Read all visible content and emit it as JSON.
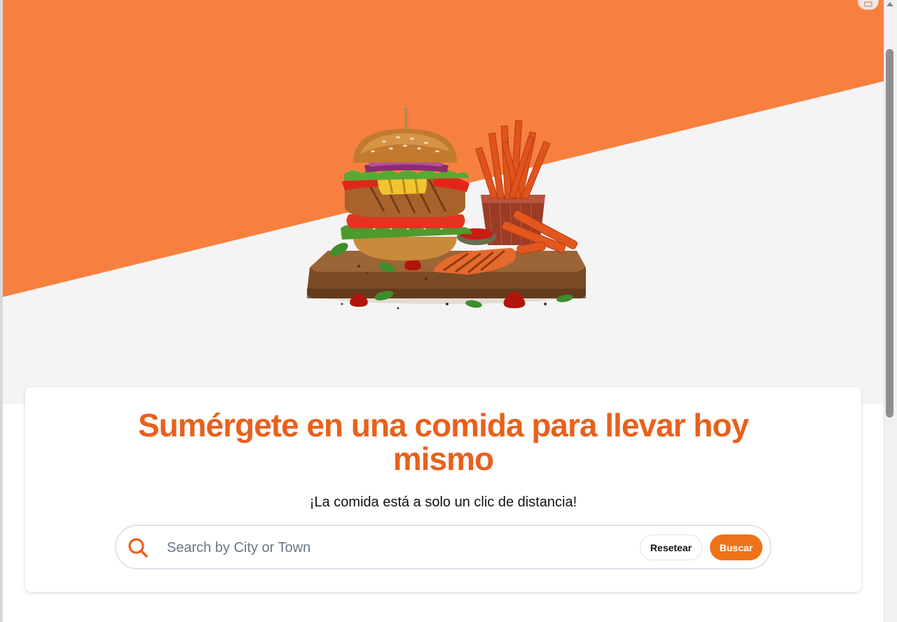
{
  "hero": {
    "image_alt": "Burger with sweet potato fries on a wooden board",
    "colors": {
      "orange": "#f7803f",
      "light_gray": "#f4f4f4"
    }
  },
  "search_section": {
    "headline": "Sumérgete en una comida para llevar hoy mismo",
    "subtitle": "¡La comida está a solo un clic de distancia!",
    "search": {
      "placeholder": "Search by City or Town",
      "value": "",
      "icon": "search-icon"
    },
    "reset_label": "Resetear",
    "search_label": "Buscar"
  },
  "theme": {
    "accent": "#e8611c",
    "button_orange": "#f07218"
  }
}
